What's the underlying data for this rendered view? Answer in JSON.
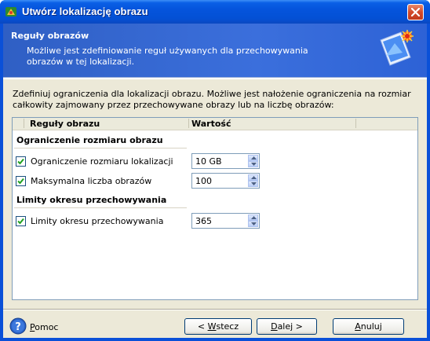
{
  "window": {
    "title": "Utwórz lokalizację obrazu"
  },
  "header": {
    "title": "Reguły obrazów",
    "description": "Możliwe jest zdefiniowanie reguł używanych dla przechowywania obrazów w tej lokalizacji."
  },
  "intro": "Zdefiniuj ograniczenia dla lokalizacji obrazu. Możliwe jest nałożenie ograniczenia na rozmiar całkowity zajmowany przez przechowywane obrazy lub na liczbę obrazów:",
  "table": {
    "col_rule": "Reguły obrazu",
    "col_value": "Wartość",
    "groups": [
      {
        "title": "Ograniczenie rozmiaru obrazu",
        "rows": [
          {
            "label": "Ograniczenie rozmiaru lokalizacji",
            "value": "10 GB",
            "checked": true
          },
          {
            "label": "Maksymalna liczba obrazów",
            "value": "100",
            "checked": true
          }
        ]
      },
      {
        "title": "Limity okresu przechowywania",
        "rows": [
          {
            "label": "Limity okresu przechowywania",
            "value": "365",
            "checked": true
          }
        ]
      }
    ]
  },
  "footer": {
    "help_rest": "omoc",
    "help_key": "P",
    "back_pre": "< ",
    "back_key": "W",
    "back_rest": "stecz",
    "next_key": "D",
    "next_rest": "alej >",
    "cancel_key": "A",
    "cancel_rest": "nuluj"
  },
  "colors": {
    "titlebar": "#0554dc",
    "header": "#3b6fdc",
    "dialog": "#ece9d8",
    "check": "#21a121"
  }
}
